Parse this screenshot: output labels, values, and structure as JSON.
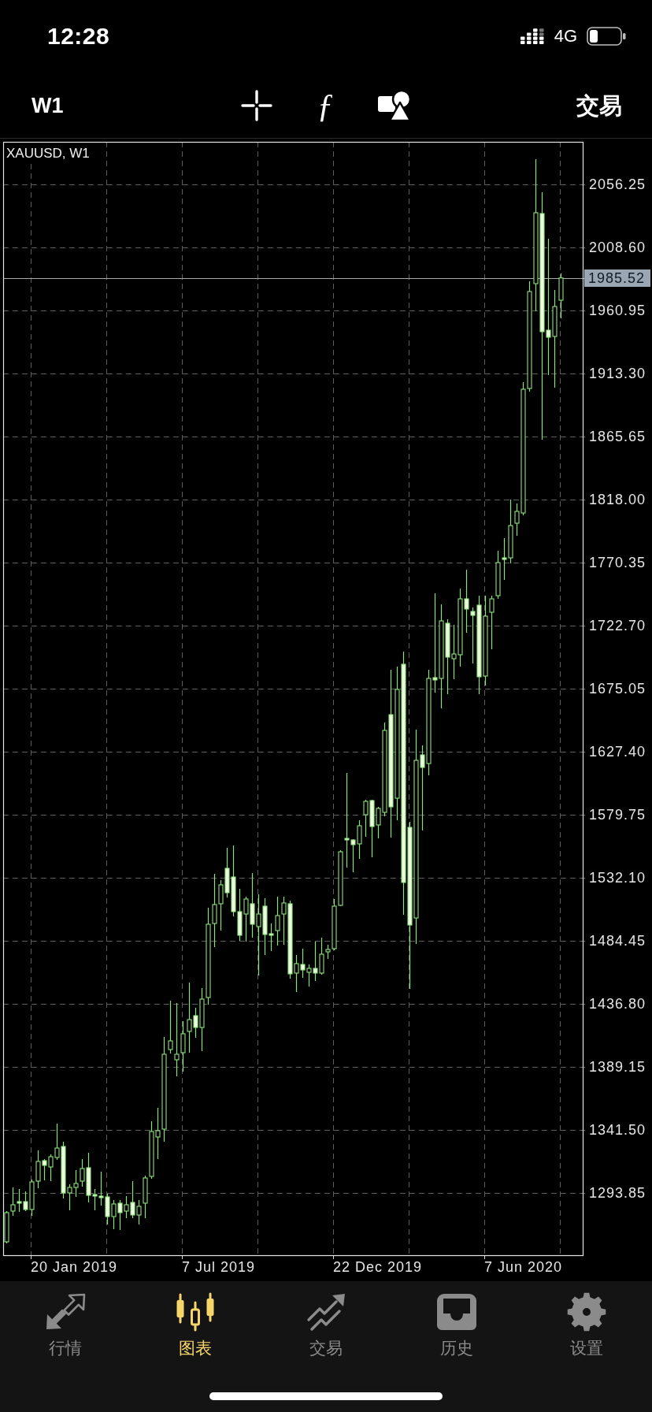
{
  "status_bar": {
    "time": "12:28",
    "network": "4G"
  },
  "toolbar": {
    "timeframe": "W1",
    "indicators": "ƒ",
    "trade": "交易"
  },
  "chart": {
    "chart_data": {
      "type": "candlestick",
      "title": "XAUUSD, W1",
      "grid": true,
      "categories": [
        null,
        null,
        null,
        null,
        null,
        null,
        null,
        null,
        null,
        null,
        null,
        null,
        null,
        null,
        null,
        null,
        null,
        null,
        null,
        null,
        null,
        null,
        null,
        null,
        null,
        null,
        null,
        null,
        null,
        null,
        null,
        null,
        null,
        null,
        null,
        null,
        null,
        null,
        null,
        null,
        null,
        null,
        null,
        null,
        null,
        null,
        null,
        null,
        null,
        null,
        null,
        null,
        null,
        null,
        null,
        null,
        null,
        null,
        null,
        null,
        null,
        null,
        null,
        null,
        null,
        null,
        null,
        null,
        null,
        null,
        null,
        null,
        null,
        null,
        null,
        null,
        null,
        null,
        null,
        null,
        null,
        null,
        null,
        null,
        null,
        null,
        null,
        null,
        null,
        null,
        null,
        null
      ],
      "ohlc": [
        [
          1256.92,
          1280.15,
          1255.73,
          1278.96
        ],
        [
          1280.15,
          1298.02,
          1276.58,
          1284.92
        ],
        [
          1287.3,
          1296.83,
          1279.56,
          1286.11
        ],
        [
          1287.3,
          1295.04,
          1280.15,
          1281.34
        ],
        [
          1281.34,
          1303.97,
          1276.58,
          1302.19
        ],
        [
          1302.78,
          1326.01,
          1297.42,
          1317.67
        ],
        [
          1318.27,
          1319.46,
          1303.38,
          1314.7
        ],
        [
          1313.5,
          1323.03,
          1302.78,
          1321.25
        ],
        [
          1320.65,
          1346.26,
          1318.86,
          1327.8
        ],
        [
          1328.99,
          1332.56,
          1289.68,
          1293.85
        ],
        [
          1293.85,
          1300.4,
          1280.75,
          1298.02
        ],
        [
          1298.02,
          1311.12,
          1290.87,
          1301.0
        ],
        [
          1302.78,
          1319.46,
          1298.62,
          1312.31
        ],
        [
          1312.91,
          1324.23,
          1286.7,
          1292.06
        ],
        [
          1292.66,
          1296.83,
          1280.75,
          1291.47
        ],
        [
          1291.47,
          1309.93,
          1284.32,
          1290.28
        ],
        [
          1290.87,
          1293.26,
          1270.03,
          1275.98
        ],
        [
          1275.98,
          1288.49,
          1266.45,
          1285.51
        ],
        [
          1286.11,
          1288.49,
          1265.86,
          1278.96
        ],
        [
          1280.15,
          1291.47,
          1274.79,
          1284.92
        ],
        [
          1286.7,
          1302.78,
          1274.79,
          1277.17
        ],
        [
          1277.17,
          1288.49,
          1270.03,
          1283.73
        ],
        [
          1286.11,
          1306.95,
          1274.79,
          1305.17
        ],
        [
          1306.36,
          1348.05,
          1304.57,
          1340.31
        ],
        [
          1336.14,
          1358.18,
          1319.46,
          1340.9
        ],
        [
          1342.09,
          1411.79,
          1332.56,
          1398.69
        ],
        [
          1402.26,
          1439.19,
          1399.28,
          1408.81
        ],
        [
          1394.52,
          1437.4,
          1382.01,
          1398.69
        ],
        [
          1399.88,
          1423.7,
          1385.58,
          1414.17
        ],
        [
          1415.96,
          1452.89,
          1399.88,
          1424.89
        ],
        [
          1427.87,
          1433.83,
          1411.19,
          1418.94
        ],
        [
          1418.94,
          1448.72,
          1401.07,
          1440.38
        ],
        [
          1441.57,
          1509.47,
          1436.21,
          1496.96
        ],
        [
          1497.55,
          1535.08,
          1479.69,
          1511.85
        ],
        [
          1512.45,
          1530.31,
          1492.19,
          1526.74
        ],
        [
          1539.25,
          1554.73,
          1517.21,
          1520.78
        ],
        [
          1532.7,
          1556.52,
          1502.92,
          1506.49
        ],
        [
          1506.49,
          1523.76,
          1484.45,
          1488.62
        ],
        [
          1504.7,
          1517.81,
          1483.86,
          1516.02
        ],
        [
          1512.45,
          1535.67,
          1486.83,
          1496.96
        ],
        [
          1495.17,
          1519.59,
          1458.25,
          1504.7
        ],
        [
          1510.66,
          1516.61,
          1473.73,
          1489.22
        ],
        [
          1489.81,
          1497.55,
          1476.71,
          1488.62
        ],
        [
          1492.19,
          1517.81,
          1480.88,
          1503.51
        ],
        [
          1504.7,
          1517.81,
          1481.47,
          1513.04
        ],
        [
          1512.45,
          1514.83,
          1455.86,
          1459.44
        ],
        [
          1460.03,
          1473.73,
          1445.74,
          1467.18
        ],
        [
          1466.58,
          1478.5,
          1456.46,
          1462.42
        ],
        [
          1460.63,
          1466.58,
          1449.91,
          1463.61
        ],
        [
          1463.61,
          1483.86,
          1454.08,
          1460.03
        ],
        [
          1460.03,
          1486.83,
          1458.84,
          1474.33
        ],
        [
          1476.11,
          1481.47,
          1470.75,
          1477.9
        ],
        [
          1478.5,
          1516.02,
          1477.31,
          1510.66
        ],
        [
          1511.25,
          1552.95,
          1510.66,
          1551.75
        ],
        [
          1561.88,
          1611.32,
          1539.84,
          1560.69
        ],
        [
          1560.69,
          1561.28,
          1536.27,
          1557.11
        ],
        [
          1557.71,
          1575.58,
          1546.39,
          1571.41
        ],
        [
          1579.75,
          1591.07,
          1563.07,
          1589.87
        ],
        [
          1590.47,
          1591.07,
          1547.58,
          1570.81
        ],
        [
          1572.01,
          1585.7,
          1561.88,
          1584.51
        ],
        [
          1581.54,
          1649.44,
          1578.56,
          1643.49
        ],
        [
          1655.4,
          1689.35,
          1562.48,
          1585.7
        ],
        [
          1592.26,
          1691.73,
          1575.58,
          1674.46
        ],
        [
          1693.52,
          1703.05,
          1504.11,
          1528.53
        ],
        [
          1570.22,
          1574.39,
          1448.12,
          1496.36
        ],
        [
          1501.72,
          1644.08,
          1482.07,
          1620.85
        ],
        [
          1625.02,
          1632.17,
          1567.84,
          1615.49
        ],
        [
          1618.47,
          1689.35,
          1609.54,
          1682.8
        ],
        [
          1683.39,
          1747.12,
          1672.08,
          1681.61
        ],
        [
          1682.8,
          1738.78,
          1660.16,
          1726.27
        ],
        [
          1724.49,
          1727.47,
          1670.88,
          1698.88
        ],
        [
          1697.69,
          1723.3,
          1682.2,
          1701.26
        ],
        [
          1700.67,
          1750.7,
          1691.73,
          1742.95
        ],
        [
          1742.95,
          1764.99,
          1717.34,
          1735.21
        ],
        [
          1733.42,
          1736.4,
          1694.11,
          1730.44
        ],
        [
          1738.19,
          1745.33,
          1670.88,
          1683.99
        ],
        [
          1684.58,
          1745.33,
          1677.44,
          1729.85
        ],
        [
          1732.83,
          1745.33,
          1704.83,
          1742.95
        ],
        [
          1745.33,
          1779.28,
          1742.95,
          1770.35
        ],
        [
          1773.92,
          1788.81,
          1757.25,
          1772.73
        ],
        [
          1773.92,
          1818.0,
          1769.76,
          1798.34
        ],
        [
          1800.13,
          1815.02,
          1790.6,
          1809.06
        ],
        [
          1807.87,
          1906.75,
          1806.09,
          1901.39
        ],
        [
          1901.99,
          1982.99,
          1899.6,
          1975.25
        ],
        [
          1981.2,
          2075.31,
          1960.36,
          2034.81
        ],
        [
          2034.21,
          2050.29,
          1863.27,
          1944.87
        ],
        [
          1946.06,
          2015.15,
          1912.11,
          1940.7
        ],
        [
          1941.3,
          1976.44,
          1902.58,
          1963.93
        ],
        [
          1968.69,
          1988.95,
          1955.0,
          1985.52
        ],
        null,
        null,
        null
      ],
      "ylim": [
        1246.79,
        2088.41
      ],
      "yticks": [
        {
          "value": 2056.25,
          "label": "2056.25"
        },
        {
          "value": 2008.6,
          "label": "2008.60"
        },
        {
          "value": 1960.95,
          "label": "1960.95"
        },
        {
          "value": 1913.3,
          "label": "1913.30"
        },
        {
          "value": 1865.65,
          "label": "1865.65"
        },
        {
          "value": 1818,
          "label": "1818.00"
        },
        {
          "value": 1770.35,
          "label": "1770.35"
        },
        {
          "value": 1722.7,
          "label": "1722.70"
        },
        {
          "value": 1675.05,
          "label": "1675.05"
        },
        {
          "value": 1627.4,
          "label": "1627.40"
        },
        {
          "value": 1579.75,
          "label": "1579.75"
        },
        {
          "value": 1532.1,
          "label": "1532.10"
        },
        {
          "value": 1484.45,
          "label": "1484.45"
        },
        {
          "value": 1436.8,
          "label": "1436.80"
        },
        {
          "value": 1389.15,
          "label": "1389.15"
        },
        {
          "value": 1341.5,
          "label": "1341.50"
        },
        {
          "value": 1293.85,
          "label": "1293.85"
        }
      ],
      "ref_lines": [
        {
          "axis": "y",
          "value": 1985.52,
          "label": "1985.52"
        }
      ]
    },
    "date_labels": [
      "20 Jan 2019",
      "7 Jul 2019",
      "22 Dec 2019",
      "7 Jun 2020"
    ]
  },
  "tabs": [
    {
      "label": "行情",
      "selected": false
    },
    {
      "label": "图表",
      "selected": true
    },
    {
      "label": "交易",
      "selected": false
    },
    {
      "label": "历史",
      "selected": false
    },
    {
      "label": "设置",
      "selected": false
    }
  ]
}
